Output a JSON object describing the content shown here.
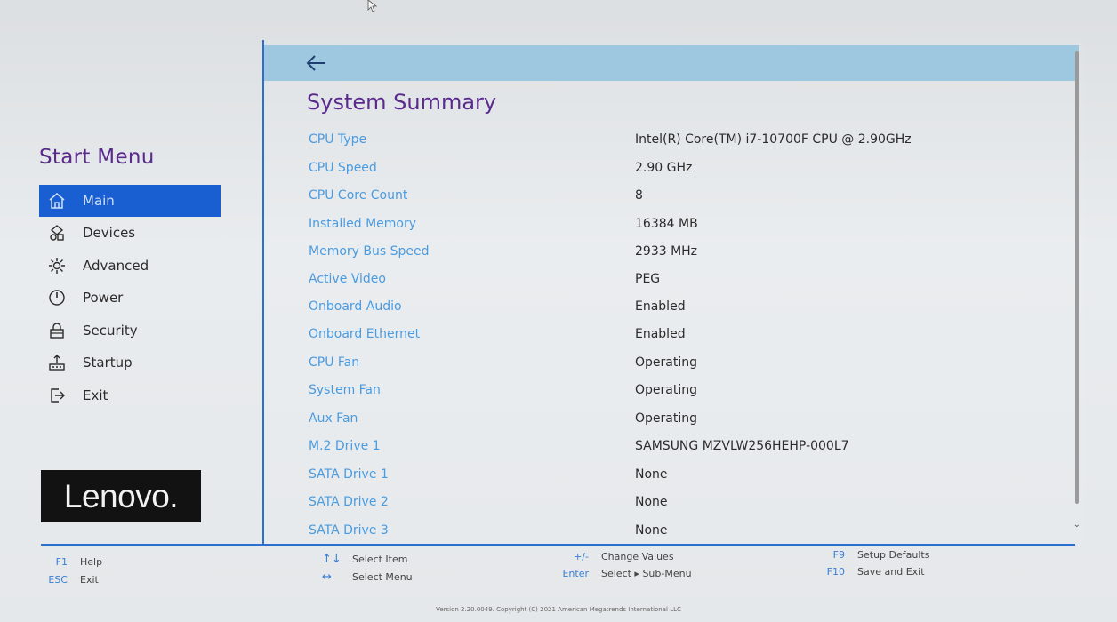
{
  "sidebar": {
    "title": "Start Menu",
    "items": [
      {
        "label": "Main",
        "icon": "home-icon",
        "active": true
      },
      {
        "label": "Devices",
        "icon": "devices-icon",
        "active": false
      },
      {
        "label": "Advanced",
        "icon": "advanced-icon",
        "active": false
      },
      {
        "label": "Power",
        "icon": "power-icon",
        "active": false
      },
      {
        "label": "Security",
        "icon": "lock-icon",
        "active": false
      },
      {
        "label": "Startup",
        "icon": "startup-icon",
        "active": false
      },
      {
        "label": "Exit",
        "icon": "exit-icon",
        "active": false
      }
    ],
    "logo_text": "Lenovo."
  },
  "panel": {
    "back_icon": "back-arrow-icon",
    "title": "System Summary",
    "rows": [
      {
        "label": "CPU Type",
        "value": "Intel(R) Core(TM) i7-10700F CPU @ 2.90GHz"
      },
      {
        "label": "CPU Speed",
        "value": "2.90 GHz"
      },
      {
        "label": "CPU Core Count",
        "value": "8"
      },
      {
        "label": "Installed Memory",
        "value": "16384 MB"
      },
      {
        "label": "Memory Bus Speed",
        "value": "2933 MHz"
      },
      {
        "label": "Active Video",
        "value": "PEG"
      },
      {
        "label": "Onboard Audio",
        "value": "Enabled"
      },
      {
        "label": "Onboard Ethernet",
        "value": "Enabled"
      },
      {
        "label": "CPU Fan",
        "value": "Operating"
      },
      {
        "label": "System Fan",
        "value": "Operating"
      },
      {
        "label": "Aux Fan",
        "value": "Operating"
      },
      {
        "label": "M.2 Drive 1",
        "value": "SAMSUNG MZVLW256HEHP-000L7"
      },
      {
        "label": "SATA Drive 1",
        "value": "None"
      },
      {
        "label": "SATA Drive 2",
        "value": "None"
      },
      {
        "label": "SATA Drive 3",
        "value": "None"
      }
    ]
  },
  "footer": {
    "f1_key": "F1",
    "f1_desc": "Help",
    "esc_key": "ESC",
    "esc_desc": "Exit",
    "select_item_keys": "↑↓",
    "select_item_desc": "Select Item",
    "select_menu_keys": "↔",
    "select_menu_desc": "Select Menu",
    "change_key": "+/-",
    "change_desc": "Change Values",
    "enter_key": "Enter",
    "enter_desc": "Select ▸ Sub-Menu",
    "f9_key": "F9",
    "f9_desc": "Setup Defaults",
    "f10_key": "F10",
    "f10_desc": "Save and Exit",
    "version": "Version 2.20.0049. Copyright (C) 2021 American Megatrends International LLC"
  },
  "colors": {
    "accent": "#1a5fd2",
    "title": "#5a2a8c",
    "label": "#4a9be0",
    "header": "#9ec8e0"
  }
}
